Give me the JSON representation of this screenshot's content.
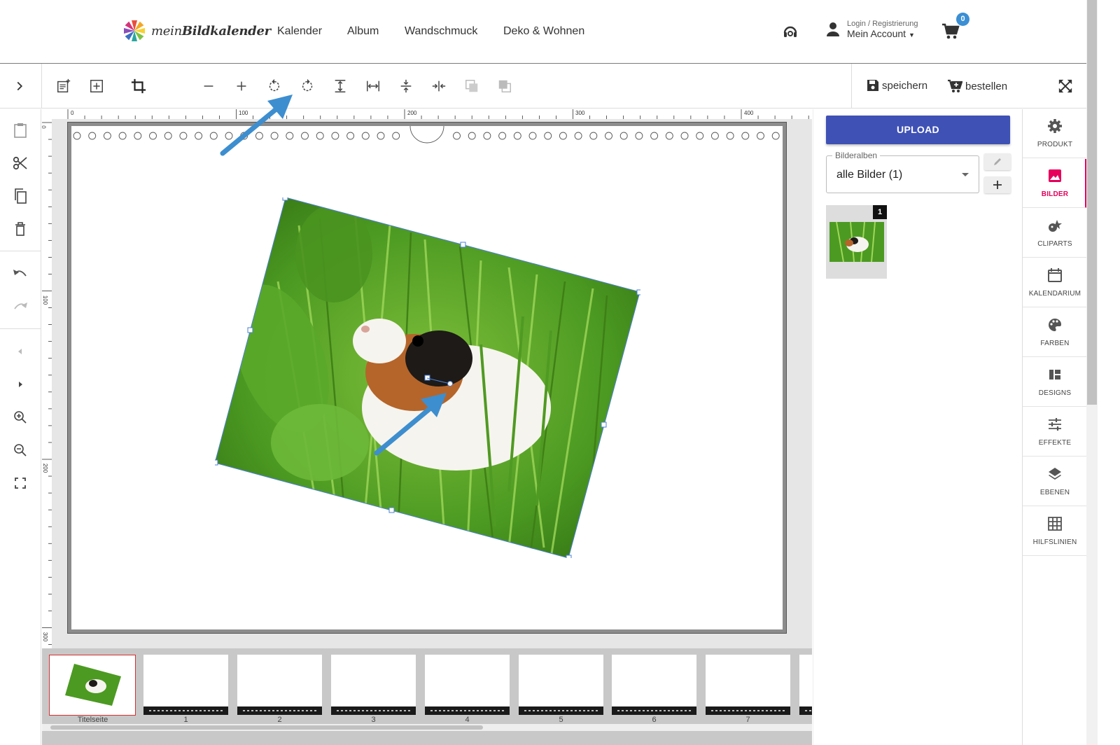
{
  "header": {
    "brand": {
      "prefix": "mein",
      "name": "Bildkalender"
    },
    "nav": [
      "Kalender",
      "Album",
      "Wandschmuck",
      "Deko & Wohnen"
    ],
    "account": {
      "small": "Login / Registrierung",
      "big": "Mein Account"
    },
    "cart_count": "0"
  },
  "toolbar": {
    "save_label": "speichern",
    "order_label": "bestellen"
  },
  "ruler": {
    "top": [
      "0",
      "100",
      "200",
      "300",
      "400"
    ],
    "left": [
      "0",
      "100",
      "200",
      "300"
    ]
  },
  "filmstrip": {
    "pages": [
      "Titelseite",
      "1",
      "2",
      "3",
      "4",
      "5",
      "6",
      "7"
    ]
  },
  "rightpanel": {
    "upload_label": "UPLOAD",
    "album_label": "Bilderalben",
    "album_value": "alle Bilder (1)",
    "image_badge": "1"
  },
  "sidenav": [
    "PRODUKT",
    "BILDER",
    "CLIPARTS",
    "KALENDARIUM",
    "FARBEN",
    "DESIGNS",
    "EFFEKTE",
    "EBENEN",
    "HILFSLINIEN"
  ],
  "colors": {
    "accent": "#3f51b5",
    "active": "#e6005c",
    "badge": "#3b8fd4",
    "annotation_arrow": "#3d8ecf",
    "ok": "#5cb85c"
  }
}
